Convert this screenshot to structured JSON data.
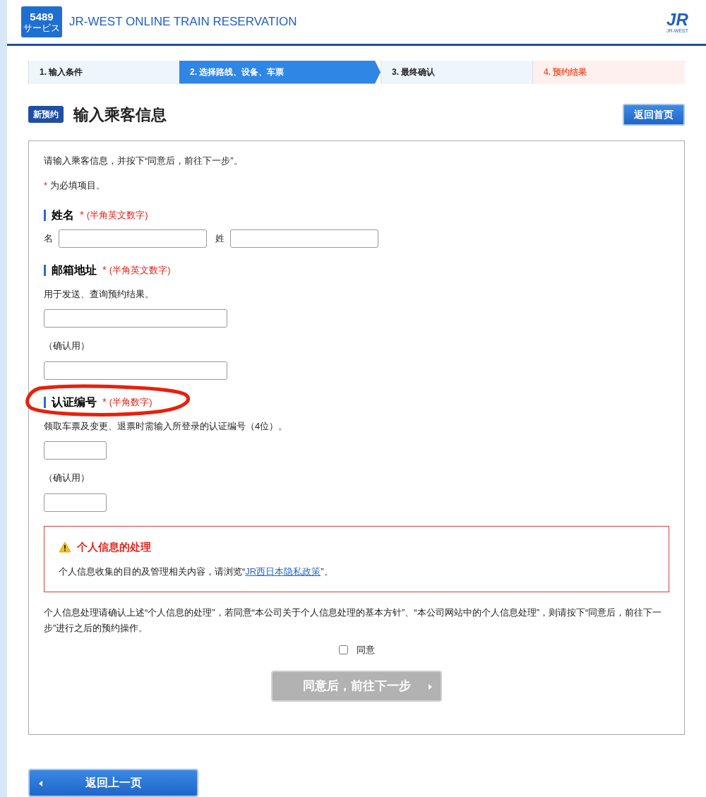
{
  "header": {
    "logo": {
      "number": "5489",
      "caption": "サービス"
    },
    "title": "JR-WEST ONLINE TRAIN RESERVATION",
    "brand": {
      "mark": "JR",
      "caption": "JR-WEST"
    }
  },
  "steps": [
    {
      "label": "1.  输入条件",
      "kind": "done"
    },
    {
      "label": "2.  选择路线、设备、车票",
      "kind": "current"
    },
    {
      "label": "3.  最终确认",
      "kind": "pending"
    },
    {
      "label": "4.  预约结果",
      "kind": "result"
    }
  ],
  "page": {
    "badge": "新预约",
    "title": "输入乘客信息",
    "home_button": "返回首页"
  },
  "form": {
    "intro": "请输入乘客信息，并按下“同意后，前往下一步”。",
    "required_note": {
      "mark": "*",
      "text": "为必填项目。"
    },
    "sections": [
      {
        "title": "姓名",
        "required": true,
        "hint": "(半角英文数字)",
        "circled": false,
        "kind": "name",
        "fields": [
          {
            "label": "名"
          },
          {
            "label": "姓"
          }
        ]
      },
      {
        "title": "邮箱地址",
        "required": true,
        "hint": "(半角英文数字)",
        "circled": false,
        "kind": "email",
        "description": "用于发送、查询预约结果。",
        "confirm_label": "（确认用）"
      },
      {
        "title": "认证编号",
        "required": true,
        "hint": "(半角数字)",
        "circled": true,
        "kind": "code",
        "description": "领取车票及变更、退票时需输入所登录的认证编号（4位）。",
        "confirm_label": "（确认用）"
      }
    ],
    "privacy": {
      "title": "个人信息的处理",
      "text_before": "个人信息收集的目的及管理相关内容，请浏览“",
      "link": "JR西日本隐私政策",
      "text_after": "”。"
    },
    "consent_text": "个人信息处理请确认上述“个人信息的处理”，若同意“本公司关于个人信息处理的基本方针”、“本公司网站中的个人信息处理”，则请按下“同意后，前往下一步”进行之后的预约操作。",
    "agree": {
      "label": "同意",
      "checked": false
    },
    "next_button": {
      "label": "同意后，前往下一步",
      "disabled": true
    }
  },
  "back_button": "返回上一页"
}
